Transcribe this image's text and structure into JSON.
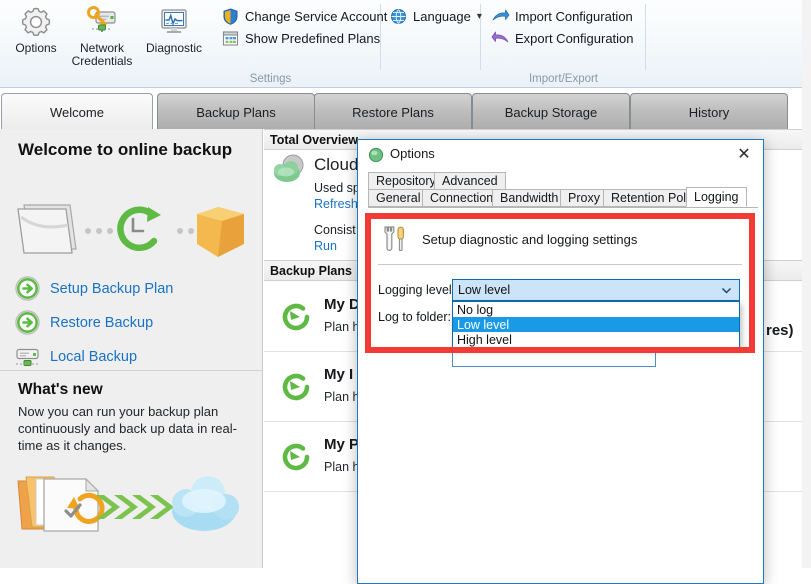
{
  "ribbon": {
    "groups": [
      {
        "label": "Settings"
      },
      {
        "label": "Import/Export"
      }
    ],
    "big_buttons": [
      {
        "name": "options",
        "label": "Options",
        "icon": "gear-icon"
      },
      {
        "name": "network-credentials",
        "label_line1": "Network",
        "label_line2": "Credentials",
        "icon": "key-server-icon"
      },
      {
        "name": "diagnostic",
        "label": "Diagnostic",
        "icon": "monitor-pulse-icon"
      }
    ],
    "small_buttons": [
      {
        "name": "change-service-account",
        "label": "Change Service Account",
        "icon": "shield-icon"
      },
      {
        "name": "show-predefined-plans",
        "label": "Show Predefined Plans",
        "icon": "grid-window-icon"
      },
      {
        "name": "language",
        "label": "Language",
        "icon": "globe-icon",
        "caret": "▾"
      },
      {
        "name": "import-configuration",
        "label": "Import Configuration",
        "icon": "blue-arrow-icon"
      },
      {
        "name": "export-configuration",
        "label": "Export Configuration",
        "icon": "purple-arrow-icon"
      }
    ]
  },
  "tabs": [
    {
      "label": "Welcome",
      "active": true
    },
    {
      "label": "Backup Plans",
      "active": false
    },
    {
      "label": "Restore Plans",
      "active": false
    },
    {
      "label": "Backup Storage",
      "active": false
    },
    {
      "label": "History",
      "active": false
    }
  ],
  "welcome": {
    "heading": "Welcome to online backup",
    "links": [
      {
        "name": "setup-backup-plan",
        "label": "Setup Backup Plan",
        "icon": "green-arrow-circle-icon"
      },
      {
        "name": "restore-backup",
        "label": "Restore Backup",
        "icon": "green-arrow-circle-icon"
      },
      {
        "name": "local-backup",
        "label": "Local Backup",
        "icon": "server-icon"
      }
    ],
    "whats_new": {
      "heading": "What's new",
      "text": "Now you can run your backup plan continuously and back up data in real-time as it changes."
    }
  },
  "content": {
    "total_overview_header": "Total Overview",
    "backup_plans_header": "Backup Plans",
    "overview": {
      "title": "Cloud",
      "used_space_label": "Used sp",
      "refresh_link": "Refresh",
      "consistency_label": "Consist",
      "run_link": "Run"
    },
    "plans": [
      {
        "name": "My D",
        "sub": "Plan ha",
        "icon": "green-refresh-icon"
      },
      {
        "name": "My I",
        "sub": "Plan ha",
        "icon": "green-refresh-icon"
      },
      {
        "name": "My P",
        "sub": "Plan ha",
        "icon": "green-refresh-icon"
      }
    ],
    "clipped_text": "res)"
  },
  "dialog": {
    "title": "Options",
    "icon": "options-sphere-icon",
    "close_label": "✕",
    "tabs_row1": [
      {
        "label": "Repository",
        "selected": false
      },
      {
        "label": "Advanced",
        "selected": false
      }
    ],
    "tabs_row2": [
      {
        "label": "General",
        "selected": false
      },
      {
        "label": "Connection",
        "selected": false
      },
      {
        "label": "Bandwidth",
        "selected": false
      },
      {
        "label": "Proxy",
        "selected": false
      },
      {
        "label": "Retention Policy",
        "selected": false
      },
      {
        "label": "Logging",
        "selected": true
      }
    ],
    "panel": {
      "heading": "Setup diagnostic and logging settings",
      "icon": "wrench-screwdriver-icon",
      "logging_level_label": "Logging level:",
      "log_to_folder_label": "Log to folder:",
      "logging_level_value": "Low level",
      "logging_level_options": [
        {
          "label": "No log",
          "highlighted": false
        },
        {
          "label": "Low level",
          "highlighted": true
        },
        {
          "label": "High level",
          "highlighted": false
        }
      ],
      "log_to_folder_value": ""
    },
    "highlight_color": "#f33b35",
    "accent_color": "#1e7ac0"
  }
}
